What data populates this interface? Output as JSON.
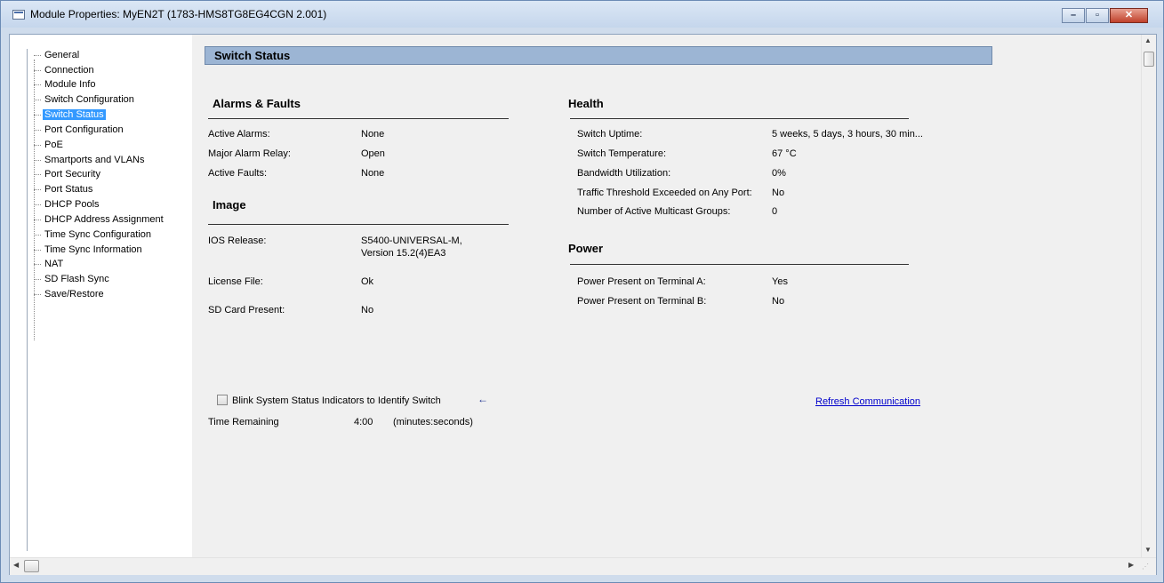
{
  "window": {
    "title": "Module Properties: MyEN2T (1783-HMS8TG8EG4CGN 2.001)",
    "minimize_icon": "minimize-icon",
    "maximize_icon": "maximize-icon",
    "close_icon": "close-icon"
  },
  "nav": {
    "items": [
      {
        "label": "General"
      },
      {
        "label": "Connection"
      },
      {
        "label": "Module Info"
      },
      {
        "label": "Switch Configuration"
      },
      {
        "label": "Switch Status",
        "selected": true
      },
      {
        "label": "Port Configuration"
      },
      {
        "label": "PoE"
      },
      {
        "label": "Smartports and VLANs"
      },
      {
        "label": "Port Security"
      },
      {
        "label": "Port Status"
      },
      {
        "label": "DHCP Pools"
      },
      {
        "label": "DHCP Address Assignment"
      },
      {
        "label": "Time Sync Configuration"
      },
      {
        "label": "Time Sync Information"
      },
      {
        "label": "NAT"
      },
      {
        "label": "SD Flash Sync"
      },
      {
        "label": "Save/Restore"
      }
    ],
    "selected_color": "#3399ff"
  },
  "page": {
    "banner_title": "Switch Status",
    "banner_color": "#9cb5d4"
  },
  "alarms": {
    "heading": "Alarms & Faults",
    "rows": [
      {
        "label": "Active Alarms:",
        "value": "None"
      },
      {
        "label": "Major Alarm Relay:",
        "value": "Open"
      },
      {
        "label": "Active Faults:",
        "value": "None"
      }
    ]
  },
  "image": {
    "heading": "Image",
    "ios_label": "IOS Release:",
    "ios_value_line1": "S5400-UNIVERSAL-M,",
    "ios_value_line2": "Version 15.2(4)EA3",
    "license_label": "License File:",
    "license_value": "Ok",
    "sd_label": "SD Card Present:",
    "sd_value": "No"
  },
  "health": {
    "heading": "Health",
    "rows": [
      {
        "label": "Switch Uptime:",
        "value": "5 weeks, 5 days, 3 hours, 30 min..."
      },
      {
        "label": "Switch Temperature:",
        "value": "67 °C"
      },
      {
        "label": "Bandwidth Utilization:",
        "value": "0%"
      },
      {
        "label": "Traffic Threshold Exceeded on Any Port:",
        "value": "No"
      },
      {
        "label": "Number of Active Multicast Groups:",
        "value": "0"
      }
    ]
  },
  "power": {
    "heading": "Power",
    "rows": [
      {
        "label": "Power Present on Terminal A:",
        "value": "Yes"
      },
      {
        "label": "Power Present on Terminal B:",
        "value": "No"
      }
    ]
  },
  "blink": {
    "checkbox_label": "Blink System Status Indicators to Identify Switch",
    "checked": false,
    "arrow_icon": "arrow-left-icon",
    "time_label": "Time Remaining",
    "time_value": "4:00",
    "time_unit": "(minutes:seconds)"
  },
  "refresh_link": "Refresh Communication",
  "link_color": "#0000cc"
}
